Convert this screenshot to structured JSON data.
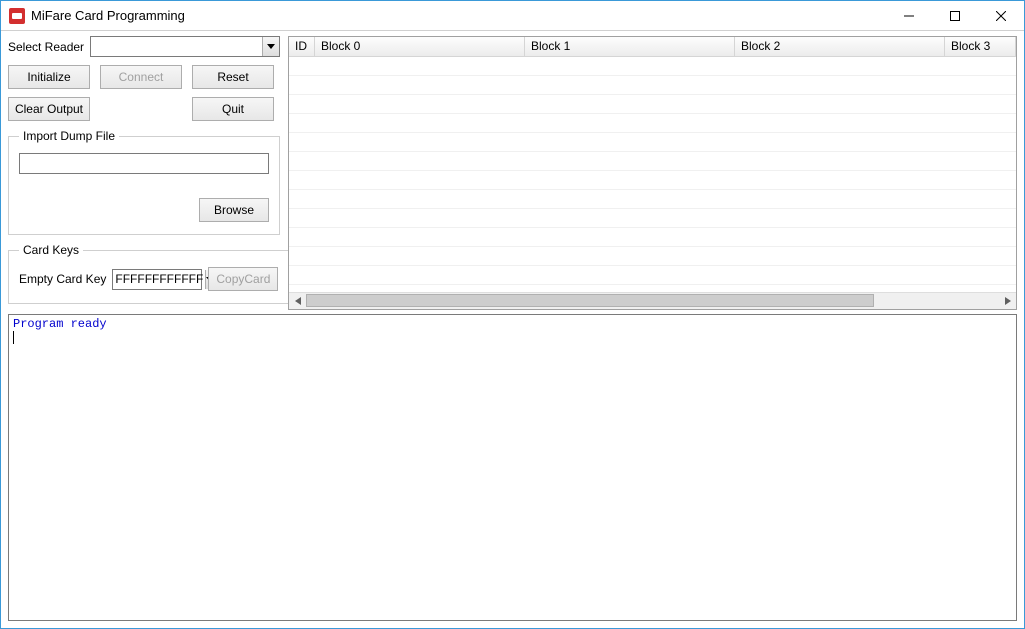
{
  "window": {
    "title": "MiFare Card Programming"
  },
  "reader": {
    "label": "Select Reader",
    "value": ""
  },
  "buttons": {
    "initialize": "Initialize",
    "connect": "Connect",
    "reset": "Reset",
    "clear_output": "Clear Output",
    "quit": "Quit",
    "browse": "Browse",
    "copycard": "CopyCard"
  },
  "import_dump": {
    "legend": "Import Dump File",
    "path": ""
  },
  "card_keys": {
    "legend": "Card Keys",
    "empty_label": "Empty Card Key",
    "empty_value": "FFFFFFFFFFFF"
  },
  "grid": {
    "columns": [
      "ID",
      "Block 0",
      "Block 1",
      "Block 2",
      "Block 3"
    ]
  },
  "output_text": "Program ready"
}
